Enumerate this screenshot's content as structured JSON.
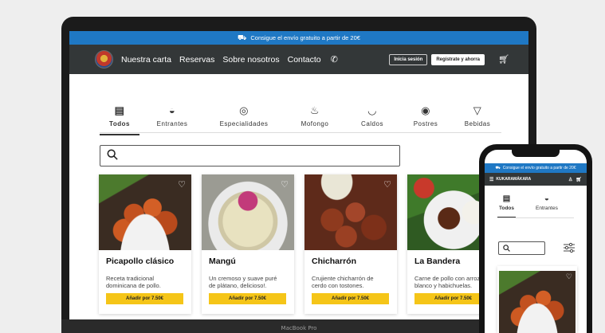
{
  "promo": {
    "text": "Consigue el envío gratuito a partir de 20€",
    "icon": "truck-icon"
  },
  "nav": {
    "links": [
      "Nuestra carta",
      "Reservas",
      "Sobre nosotros",
      "Contacto"
    ],
    "login_label": "Inicia sesión",
    "register_label": "Regístrate y ahorra"
  },
  "categories": [
    {
      "label": "Todos",
      "icon": "menu-book-icon",
      "active": true
    },
    {
      "label": "Entrantes",
      "icon": "bowl-icon",
      "active": false
    },
    {
      "label": "Especialidades",
      "icon": "plate-icon",
      "active": false
    },
    {
      "label": "Mofongo",
      "icon": "pot-icon",
      "active": false
    },
    {
      "label": "Caldos",
      "icon": "soup-icon",
      "active": false
    },
    {
      "label": "Postres",
      "icon": "ice-cream-icon",
      "active": false
    },
    {
      "label": "Bebidas",
      "icon": "cocktail-icon",
      "active": false
    }
  ],
  "search": {
    "placeholder": ""
  },
  "products": [
    {
      "name": "Picapollo clásico",
      "desc1": "Receta tradicional",
      "desc2": "dominicana de pollo.",
      "button": "Añadir por 7.50€"
    },
    {
      "name": "Mangú",
      "desc1": "Un cremoso y suave puré",
      "desc2": "de plátano, delicioso!.",
      "button": "Añadir por 7.50€"
    },
    {
      "name": "Chicharrón",
      "desc1": "Crujiente chicharrón de",
      "desc2": "cerdo con tostones.",
      "button": "Añadir por 7.50€"
    },
    {
      "name": "La Bandera",
      "desc1": "Carne de pollo con arroz",
      "desc2": "blanco y habichuelas.",
      "button": "Añadir por 7.50€"
    }
  ],
  "laptop": {
    "brand": "MacBook Pro"
  },
  "mobile": {
    "promo_text": "Consigue el envío gratuito a partir de 20€",
    "brand": "KUKARAMÁKARA",
    "categories": [
      "Todos",
      "Entrantes"
    ]
  },
  "colors": {
    "promo": "#1f78c4",
    "nav": "#333738",
    "add_button": "#f5c518"
  }
}
